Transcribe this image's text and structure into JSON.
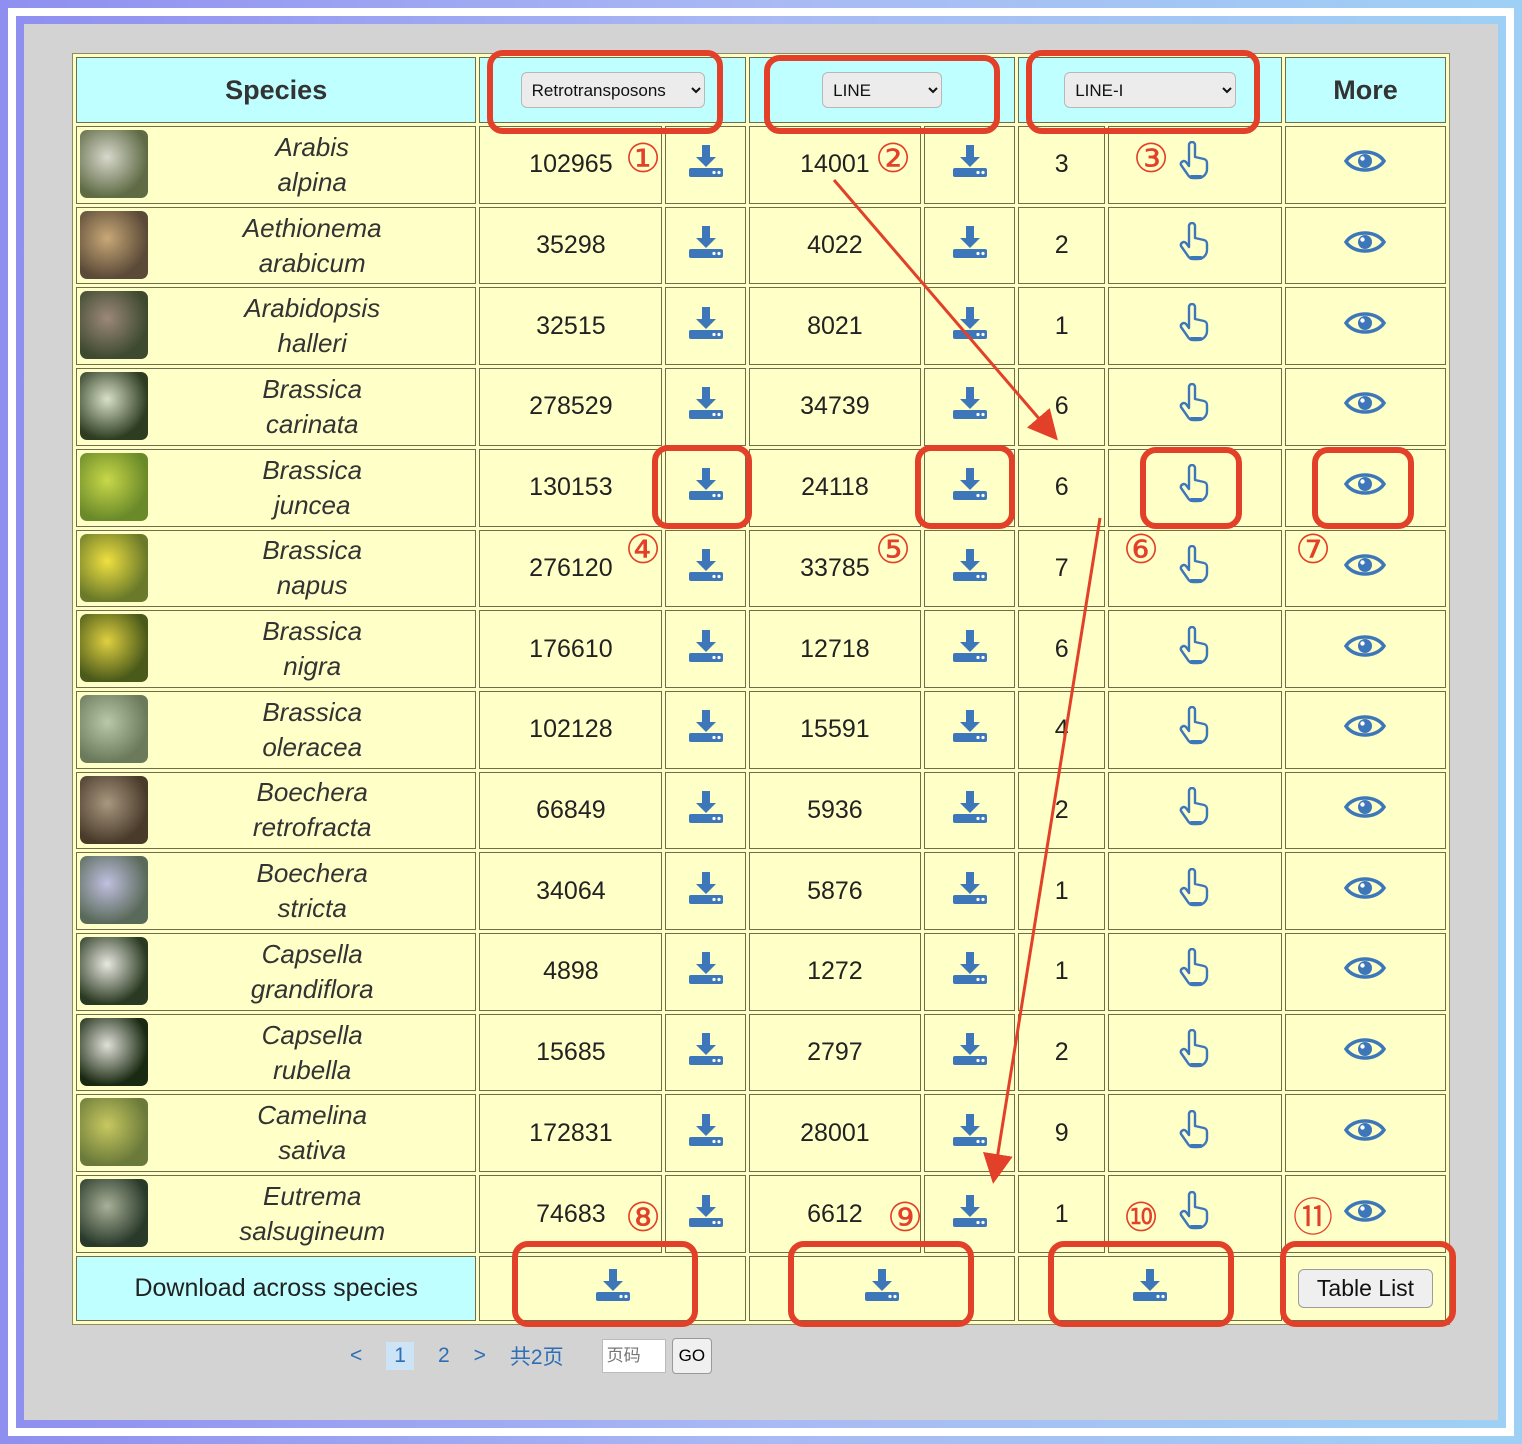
{
  "header": {
    "species": "Species",
    "select1": {
      "selected": "Retrotransposons"
    },
    "select2": {
      "selected": "LINE"
    },
    "select3": {
      "selected": "LINE-I"
    },
    "more": "More"
  },
  "rows": [
    {
      "genus": "Arabis",
      "epithet": "alpina",
      "retro": "102965",
      "line": "14001",
      "linei": "3",
      "thumb": [
        "#5f6b45",
        "#d8d8cc"
      ]
    },
    {
      "genus": "Aethionema",
      "epithet": "arabicum",
      "retro": "35298",
      "line": "4022",
      "linei": "2",
      "thumb": [
        "#5b4a38",
        "#c8a877"
      ]
    },
    {
      "genus": "Arabidopsis",
      "epithet": "halleri",
      "retro": "32515",
      "line": "8021",
      "linei": "1",
      "thumb": [
        "#3e4a30",
        "#9c8878"
      ]
    },
    {
      "genus": "Brassica",
      "epithet": "carinata",
      "retro": "278529",
      "line": "34739",
      "linei": "6",
      "thumb": [
        "#2e3d22",
        "#d8e0c8"
      ]
    },
    {
      "genus": "Brassica",
      "epithet": "juncea",
      "retro": "130153",
      "line": "24118",
      "linei": "6",
      "thumb": [
        "#6a8a2a",
        "#c8d848"
      ]
    },
    {
      "genus": "Brassica",
      "epithet": "napus",
      "retro": "276120",
      "line": "33785",
      "linei": "7",
      "thumb": [
        "#6a7a2a",
        "#f0e040"
      ]
    },
    {
      "genus": "Brassica",
      "epithet": "nigra",
      "retro": "176610",
      "line": "12718",
      "linei": "6",
      "thumb": [
        "#4a5a1a",
        "#e0d040"
      ]
    },
    {
      "genus": "Brassica",
      "epithet": "oleracea",
      "retro": "102128",
      "line": "15591",
      "linei": "4",
      "thumb": [
        "#6a7a5a",
        "#b8c8a8"
      ]
    },
    {
      "genus": "Boechera",
      "epithet": "retrofracta",
      "retro": "66849",
      "line": "5936",
      "linei": "2",
      "thumb": [
        "#4a3a2a",
        "#a89880"
      ]
    },
    {
      "genus": "Boechera",
      "epithet": "stricta",
      "retro": "34064",
      "line": "5876",
      "linei": "1",
      "thumb": [
        "#5a6a5a",
        "#c0c0e0"
      ]
    },
    {
      "genus": "Capsella",
      "epithet": "grandiflora",
      "retro": "4898",
      "line": "1272",
      "linei": "1",
      "thumb": [
        "#2a3a22",
        "#e8e8e0"
      ]
    },
    {
      "genus": "Capsella",
      "epithet": "rubella",
      "retro": "15685",
      "line": "2797",
      "linei": "2",
      "thumb": [
        "#1a2a12",
        "#e0e0d8"
      ]
    },
    {
      "genus": "Camelina",
      "epithet": "sativa",
      "retro": "172831",
      "line": "28001",
      "linei": "9",
      "thumb": [
        "#6a7a3a",
        "#c8c860"
      ]
    },
    {
      "genus": "Eutrema",
      "epithet": "salsugineum",
      "retro": "74683",
      "line": "6612",
      "linei": "1",
      "thumb": [
        "#2a3a2a",
        "#a8b098"
      ]
    }
  ],
  "footer": {
    "label": "Download across species",
    "table_list": "Table List"
  },
  "pager": {
    "prev": "<",
    "page1": "1",
    "page2": "2",
    "next": ">",
    "total": "共2页",
    "input_placeholder": "页码",
    "go": "GO"
  },
  "annotations": [
    "①",
    "②",
    "③",
    "④",
    "⑤",
    "⑥",
    "⑦",
    "⑧",
    "⑨",
    "⑩",
    "⑪"
  ],
  "colors": {
    "header_bg": "#bfffff",
    "cell_bg": "#ffffc8",
    "icon_blue": "#3d77b9",
    "annotation_red": "#e3402a"
  },
  "icons": {
    "download": "download-icon",
    "pointer": "hand-pointer-icon",
    "view": "eye-icon"
  }
}
